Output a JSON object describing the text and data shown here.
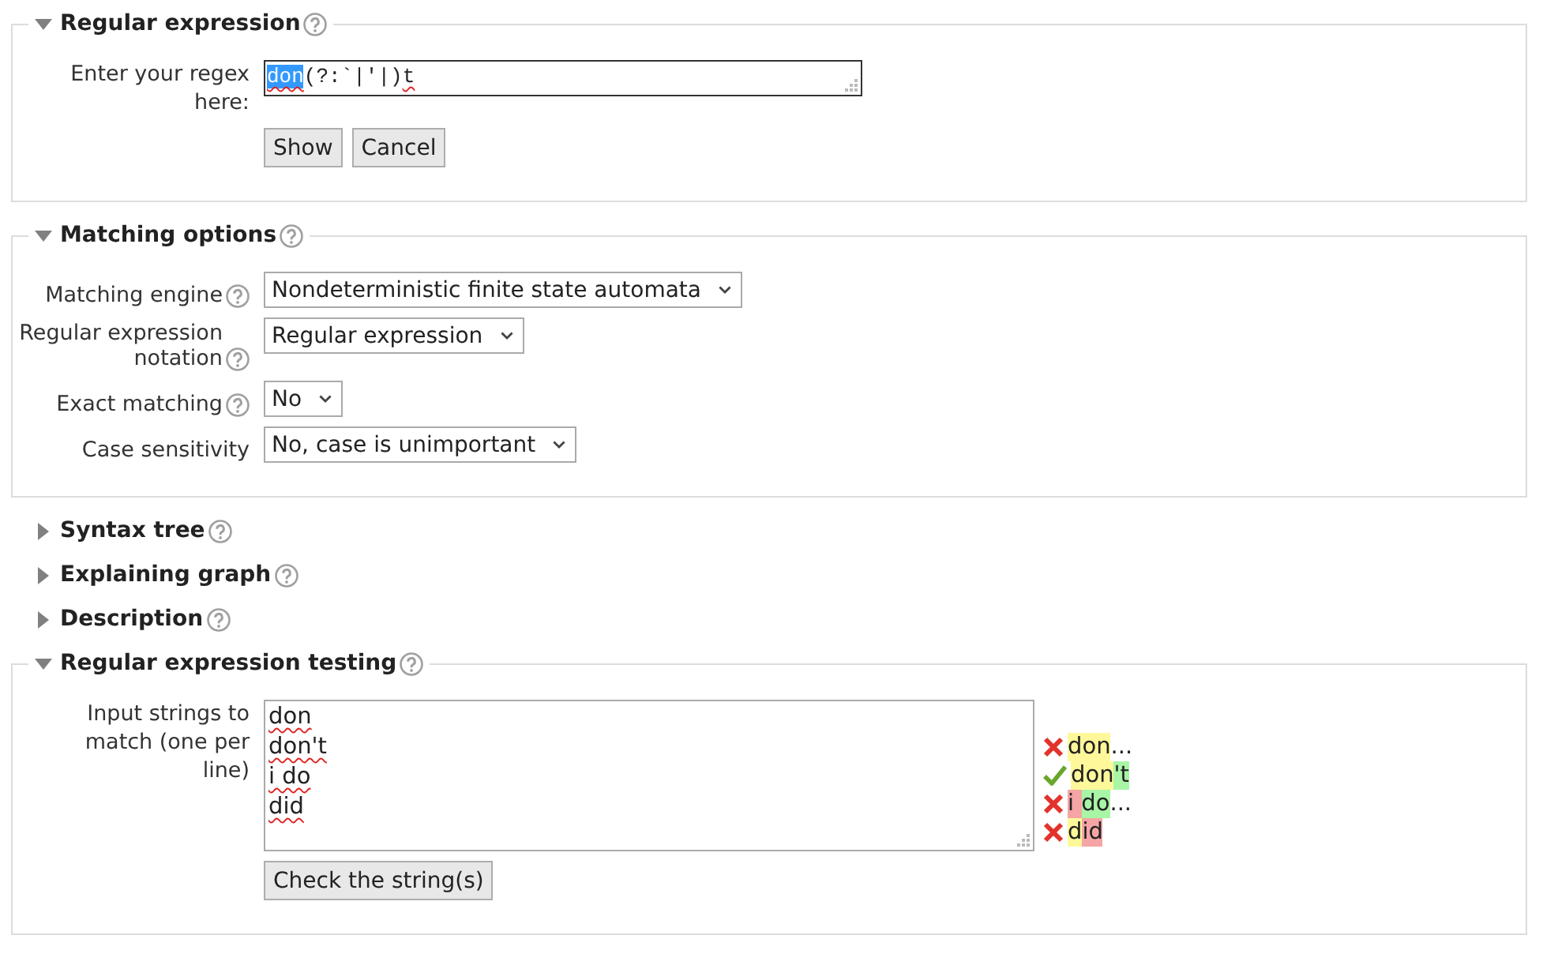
{
  "sections": [
    {
      "kind": "regex",
      "title": "Regular expression",
      "help": true,
      "expanded": true,
      "label": "Enter your regex here:",
      "regex": [
        {
          "text": "don",
          "selected": true,
          "misspelled": true
        },
        {
          "text": "(?:`|'|)",
          "selected": false,
          "misspelled": false
        },
        {
          "text": "t",
          "selected": false,
          "misspelled": true
        }
      ],
      "buttons": [
        "Show",
        "Cancel"
      ]
    },
    {
      "kind": "options",
      "title": "Matching options",
      "help": true,
      "expanded": true,
      "fields": [
        {
          "label": "Matching engine",
          "help": true,
          "value": "Nondeterministic finite state automata"
        },
        {
          "label": "Regular expression notation",
          "help": true,
          "value": "Regular expression"
        },
        {
          "label": "Exact matching",
          "help": true,
          "value": "No"
        },
        {
          "label": "Case sensitivity",
          "value": "No, case is unimportant"
        }
      ]
    },
    {
      "kind": "collapsible",
      "title": "Syntax tree",
      "help": true,
      "expanded": false
    },
    {
      "kind": "collapsible",
      "title": "Explaining graph",
      "help": true,
      "expanded": false
    },
    {
      "kind": "collapsible",
      "title": "Description",
      "help": true,
      "expanded": false
    },
    {
      "kind": "testing",
      "title": "Regular expression testing",
      "help": true,
      "expanded": true,
      "label": "Input strings to match (one per line)",
      "strings": [
        {
          "text": "don",
          "misspelled": true
        },
        {
          "text": "don't",
          "misspelled": true
        },
        {
          "text": "i do",
          "misspelled": true
        },
        {
          "text": "did",
          "misspelled": true
        }
      ],
      "results": [
        {
          "passed": false,
          "segments": [
            {
              "text": "don",
              "kind": "matched"
            },
            {
              "text": "...",
              "kind": "plain"
            }
          ]
        },
        {
          "passed": true,
          "segments": [
            {
              "text": "don",
              "kind": "matched"
            },
            {
              "text": "'t",
              "kind": "next"
            }
          ]
        },
        {
          "passed": false,
          "segments": [
            {
              "text": "i ",
              "kind": "wrong"
            },
            {
              "text": "do",
              "kind": "next"
            },
            {
              "text": "...",
              "kind": "plain"
            }
          ]
        },
        {
          "passed": false,
          "segments": [
            {
              "text": "d",
              "kind": "matched"
            },
            {
              "text": "id",
              "kind": "wrong"
            }
          ]
        }
      ],
      "button": "Check the string(s)"
    }
  ]
}
